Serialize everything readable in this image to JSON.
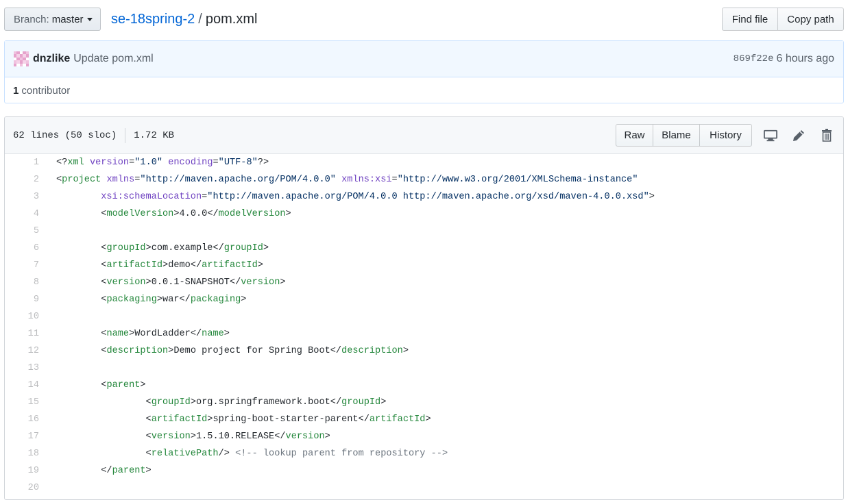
{
  "branch": {
    "label": "Branch:",
    "value": "master"
  },
  "breadcrumb": {
    "repo": "se-18spring-2",
    "separator": "/",
    "file": "pom.xml"
  },
  "top_buttons": {
    "find_file": "Find file",
    "copy_path": "Copy path"
  },
  "commit": {
    "author": "dnzlike",
    "message": "Update pom.xml",
    "sha": "869f22e",
    "time": "6 hours ago"
  },
  "contributors": {
    "count": "1",
    "label": "contributor"
  },
  "file_info": {
    "lines": "62 lines (50 sloc)",
    "size": "1.72 KB"
  },
  "file_buttons": {
    "raw": "Raw",
    "blame": "Blame",
    "history": "History"
  },
  "icons": [
    "desktop-icon",
    "pencil-icon",
    "trash-icon"
  ],
  "colors": {
    "link": "#0366d6",
    "tag": "#22863a",
    "attr": "#6f42c1",
    "string": "#032f62",
    "comment": "#6a737d"
  },
  "code_lines": [
    "<?xml version=\"1.0\" encoding=\"UTF-8\"?>",
    "<project xmlns=\"http://maven.apache.org/POM/4.0.0\" xmlns:xsi=\"http://www.w3.org/2001/XMLSchema-instance\"",
    "\txsi:schemaLocation=\"http://maven.apache.org/POM/4.0.0 http://maven.apache.org/xsd/maven-4.0.0.xsd\">",
    "\t<modelVersion>4.0.0</modelVersion>",
    "",
    "\t<groupId>com.example</groupId>",
    "\t<artifactId>demo</artifactId>",
    "\t<version>0.0.1-SNAPSHOT</version>",
    "\t<packaging>war</packaging>",
    "",
    "\t<name>WordLadder</name>",
    "\t<description>Demo project for Spring Boot</description>",
    "",
    "\t<parent>",
    "\t\t<groupId>org.springframework.boot</groupId>",
    "\t\t<artifactId>spring-boot-starter-parent</artifactId>",
    "\t\t<version>1.5.10.RELEASE</version>",
    "\t\t<relativePath/> <!-- lookup parent from repository -->",
    "\t</parent>",
    ""
  ]
}
